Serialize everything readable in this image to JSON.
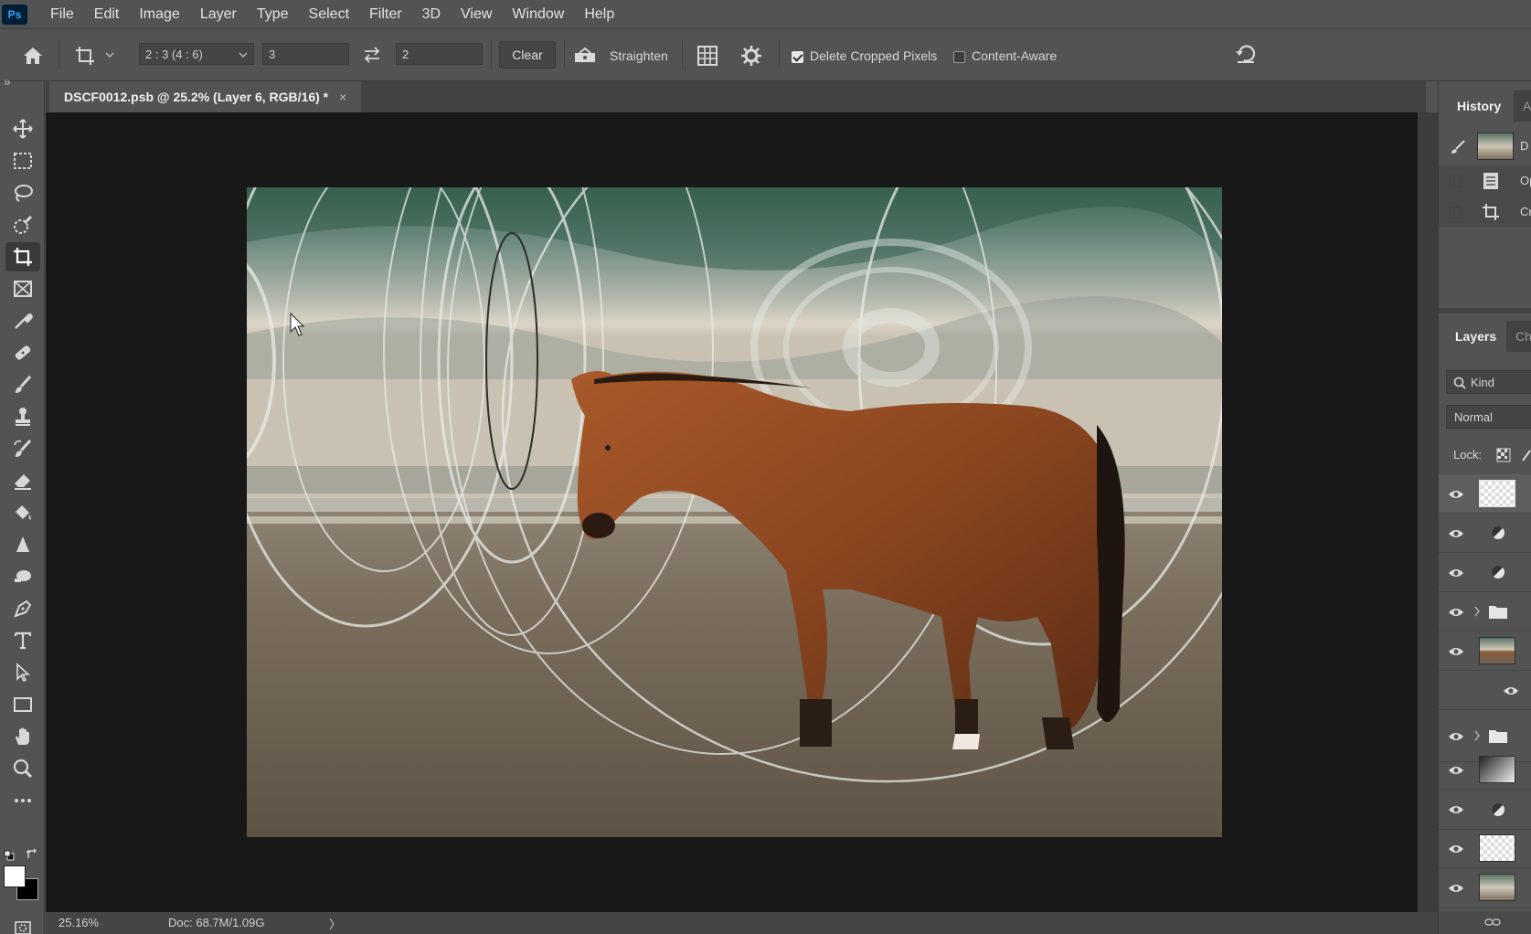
{
  "app": {
    "logo": "Ps",
    "menu": [
      "File",
      "Edit",
      "Image",
      "Layer",
      "Type",
      "Select",
      "Filter",
      "3D",
      "View",
      "Window",
      "Help"
    ]
  },
  "options_bar": {
    "ratio_preset": "2 : 3 (4 : 6)",
    "ratio_width": "3",
    "ratio_height": "2",
    "clear_label": "Clear",
    "straighten_label": "Straighten",
    "delete_cropped_label": "Delete Cropped Pixels",
    "delete_cropped_checked": true,
    "content_aware_label": "Content-Aware",
    "content_aware_checked": false
  },
  "toolbar": {
    "collapse_glyph": "»",
    "tools": [
      "move-tool",
      "marquee-tool",
      "lasso-tool",
      "quick-selection-tool",
      "crop-tool",
      "frame-tool",
      "eyedropper-tool",
      "healing-brush-tool",
      "brush-tool",
      "clone-stamp-tool",
      "history-brush-tool",
      "eraser-tool",
      "paint-bucket-tool",
      "blur-tool",
      "dodge-tool",
      "pen-tool",
      "type-tool",
      "path-selection-tool",
      "rectangle-tool",
      "hand-tool",
      "zoom-tool",
      "more-tools"
    ],
    "active_tool": "crop-tool",
    "foreground_color": "#ffffff",
    "background_color": "#000000"
  },
  "document": {
    "tab_title": "DSCF0012.psb @ 25.2% (Layer 6, RGB/16) *",
    "close_glyph": "×"
  },
  "status": {
    "zoom": "25.16%",
    "doc_size": "Doc: 68.7M/1.09G",
    "arrow": "〉"
  },
  "history_panel": {
    "tab": "History",
    "second_tab": "A",
    "items": [
      {
        "icon": "snapshot-thumbnail",
        "label": "D"
      },
      {
        "icon": "document-icon",
        "label": "Op"
      },
      {
        "icon": "crop-icon",
        "label": "Cr"
      }
    ]
  },
  "layers_panel": {
    "tab": "Layers",
    "second_tab": "Ch",
    "filter_label": "Kind",
    "blend_mode": "Normal",
    "lock_label": "Lock:",
    "layers": [
      {
        "thumb": "transparent",
        "visible": true,
        "selected": true
      },
      {
        "thumb": "adjustment",
        "visible": true
      },
      {
        "thumb": "adjustment",
        "visible": true
      },
      {
        "thumb": "folder",
        "visible": true,
        "group": true
      },
      {
        "thumb": "photo-smart",
        "visible": true
      },
      {
        "thumb": "sub-effect",
        "visible": true,
        "indent": true
      },
      {
        "thumb": "folder",
        "visible": true,
        "group": true
      },
      {
        "thumb": "gradient",
        "visible": true
      },
      {
        "thumb": "adjustment",
        "visible": true
      },
      {
        "thumb": "transparent",
        "visible": true
      },
      {
        "thumb": "photo",
        "visible": true
      }
    ]
  }
}
